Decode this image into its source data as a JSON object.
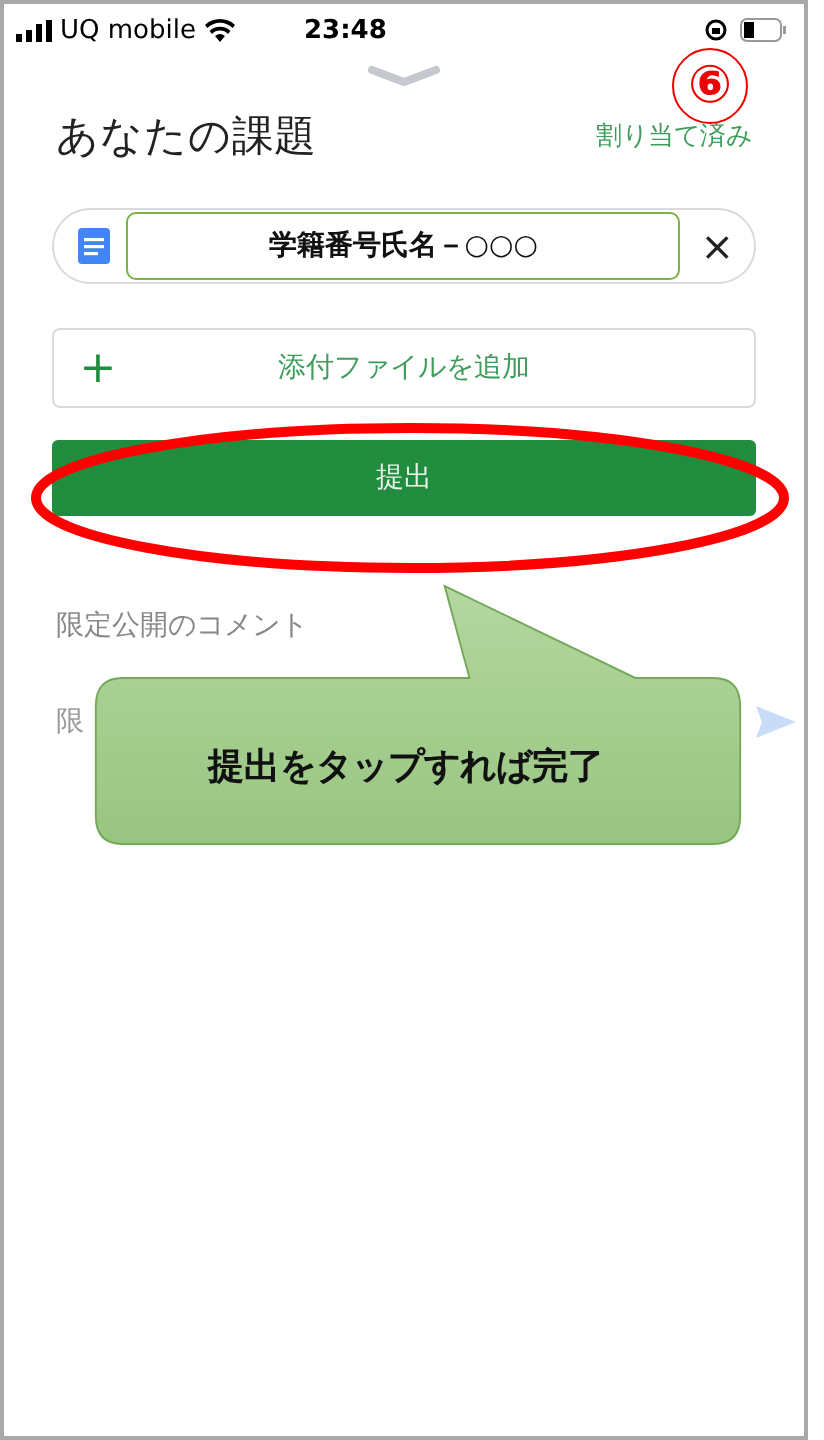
{
  "status_bar": {
    "carrier": "UQ mobile",
    "time": "23:48"
  },
  "header": {
    "title": "あなたの課題",
    "status": "割り当て済み"
  },
  "attachment": {
    "name": "学籍番号氏名－○○○",
    "remove": "×"
  },
  "add_button": {
    "icon": "+",
    "label": "添付ファイルを追加"
  },
  "submit_button": {
    "label": "提出"
  },
  "comments": {
    "heading": "限定公開のコメント",
    "placeholder": "限"
  },
  "annotations": {
    "step": "⑥",
    "callout": "提出をタップすれば完了"
  }
}
